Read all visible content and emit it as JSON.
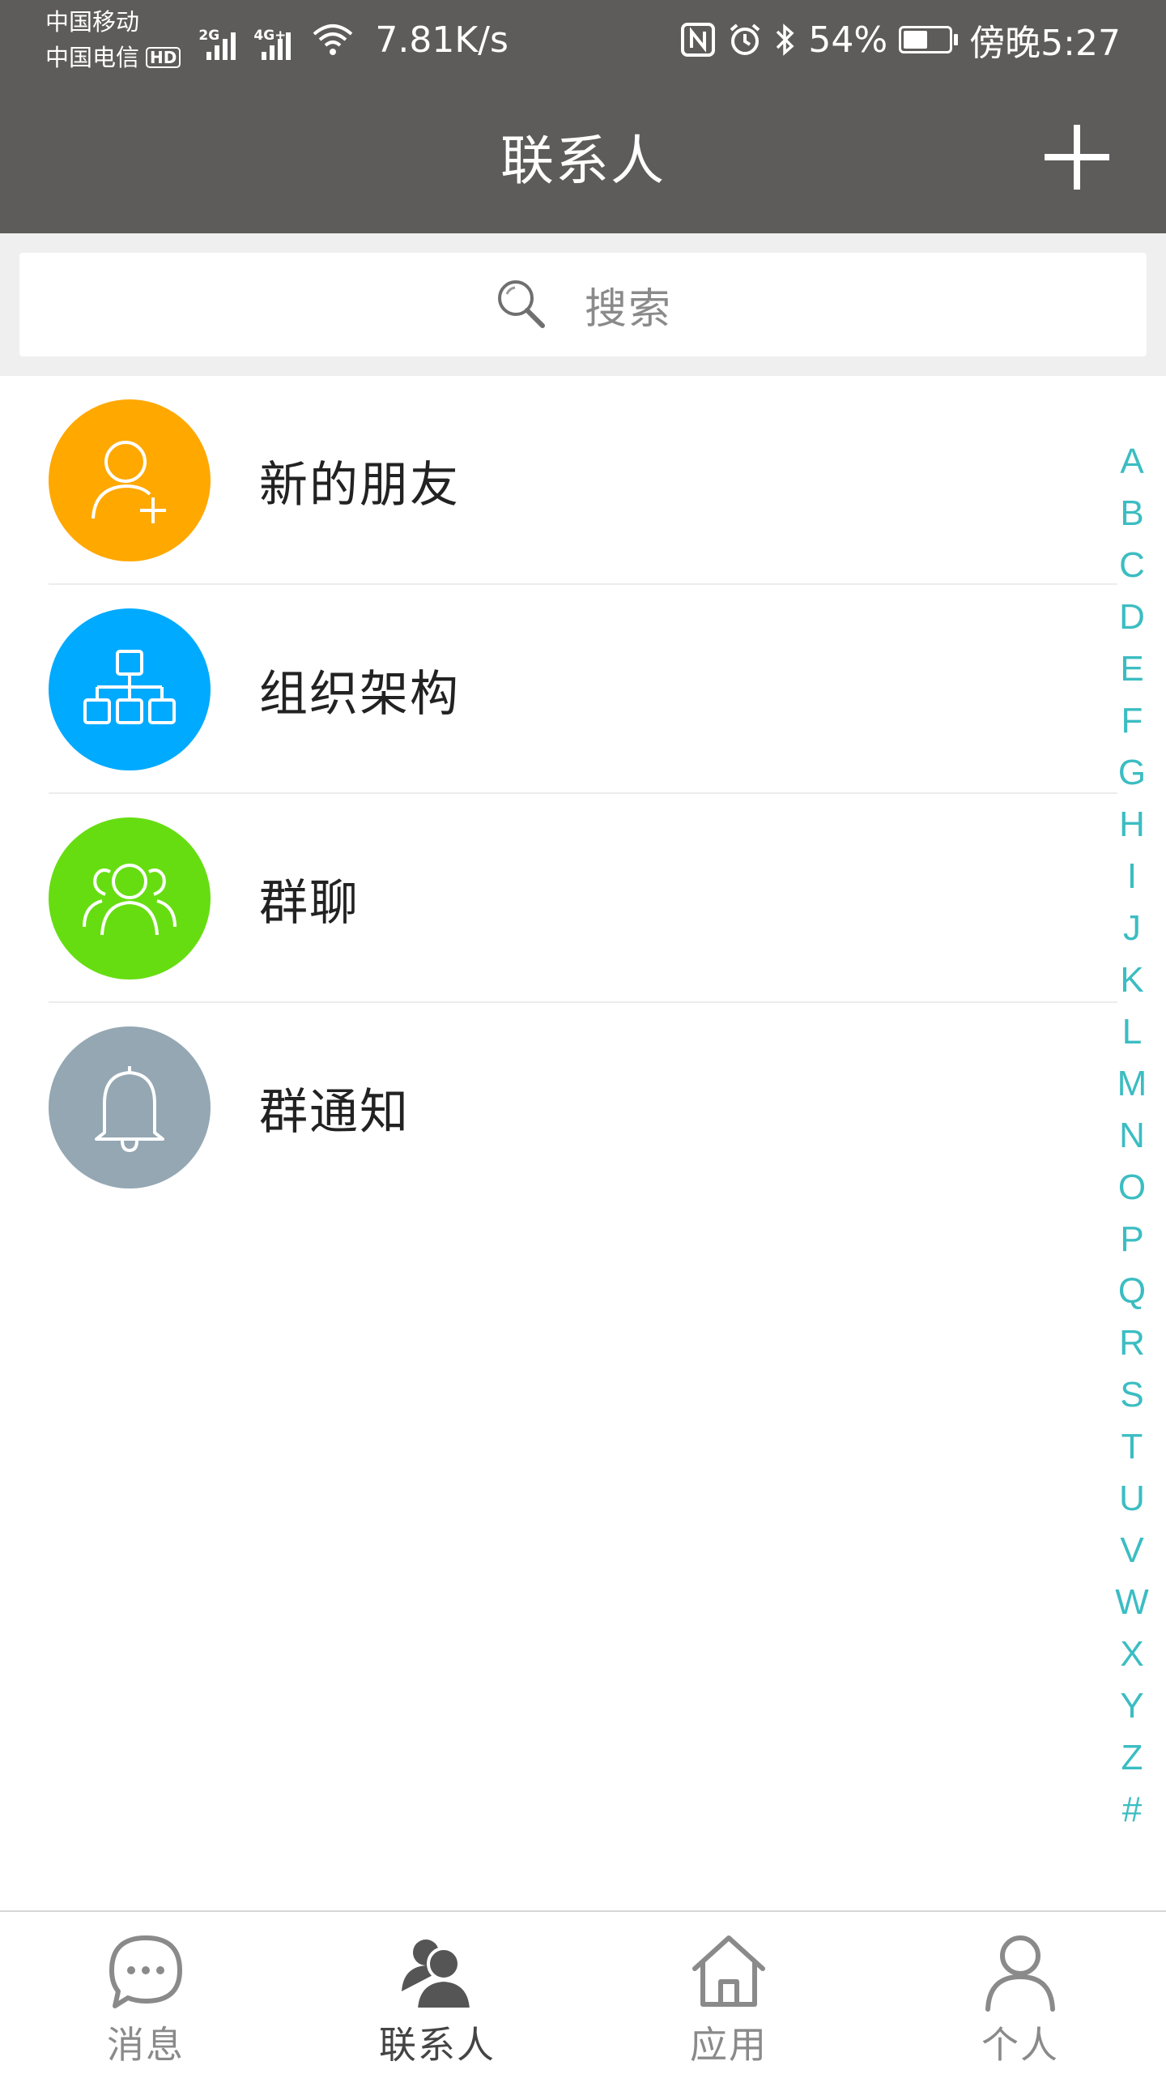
{
  "status_bar": {
    "carrier_1": "中国移动",
    "carrier_2": "中国电信",
    "hd_badge": "HD",
    "signal_1_tag": "2G",
    "signal_2_tag": "4G+",
    "net_speed": "7.81K/s",
    "battery_percent": "54%",
    "battery_level": 0.54,
    "time": "傍晚5:27"
  },
  "header": {
    "title": "联系人"
  },
  "search": {
    "placeholder": "搜索"
  },
  "contact_list": {
    "items": [
      {
        "label": "新的朋友",
        "icon": "add-user-icon",
        "color": "#ffa800"
      },
      {
        "label": "组织架构",
        "icon": "org-chart-icon",
        "color": "#00aaff"
      },
      {
        "label": "群聊",
        "icon": "group-icon",
        "color": "#66dd11"
      },
      {
        "label": "群通知",
        "icon": "bell-icon",
        "color": "#94a7b3"
      }
    ]
  },
  "index_bar": {
    "letters": [
      "A",
      "B",
      "C",
      "D",
      "E",
      "F",
      "G",
      "H",
      "I",
      "J",
      "K",
      "L",
      "M",
      "N",
      "O",
      "P",
      "Q",
      "R",
      "S",
      "T",
      "U",
      "V",
      "W",
      "X",
      "Y",
      "Z",
      "#"
    ],
    "color": "#3bbdc2"
  },
  "bottom_nav": {
    "items": [
      {
        "label": "消息",
        "icon": "chat-bubble-icon",
        "active": false
      },
      {
        "label": "联系人",
        "icon": "contacts-icon",
        "active": true
      },
      {
        "label": "应用",
        "icon": "home-icon",
        "active": false
      },
      {
        "label": "个人",
        "icon": "person-icon",
        "active": false
      }
    ]
  }
}
